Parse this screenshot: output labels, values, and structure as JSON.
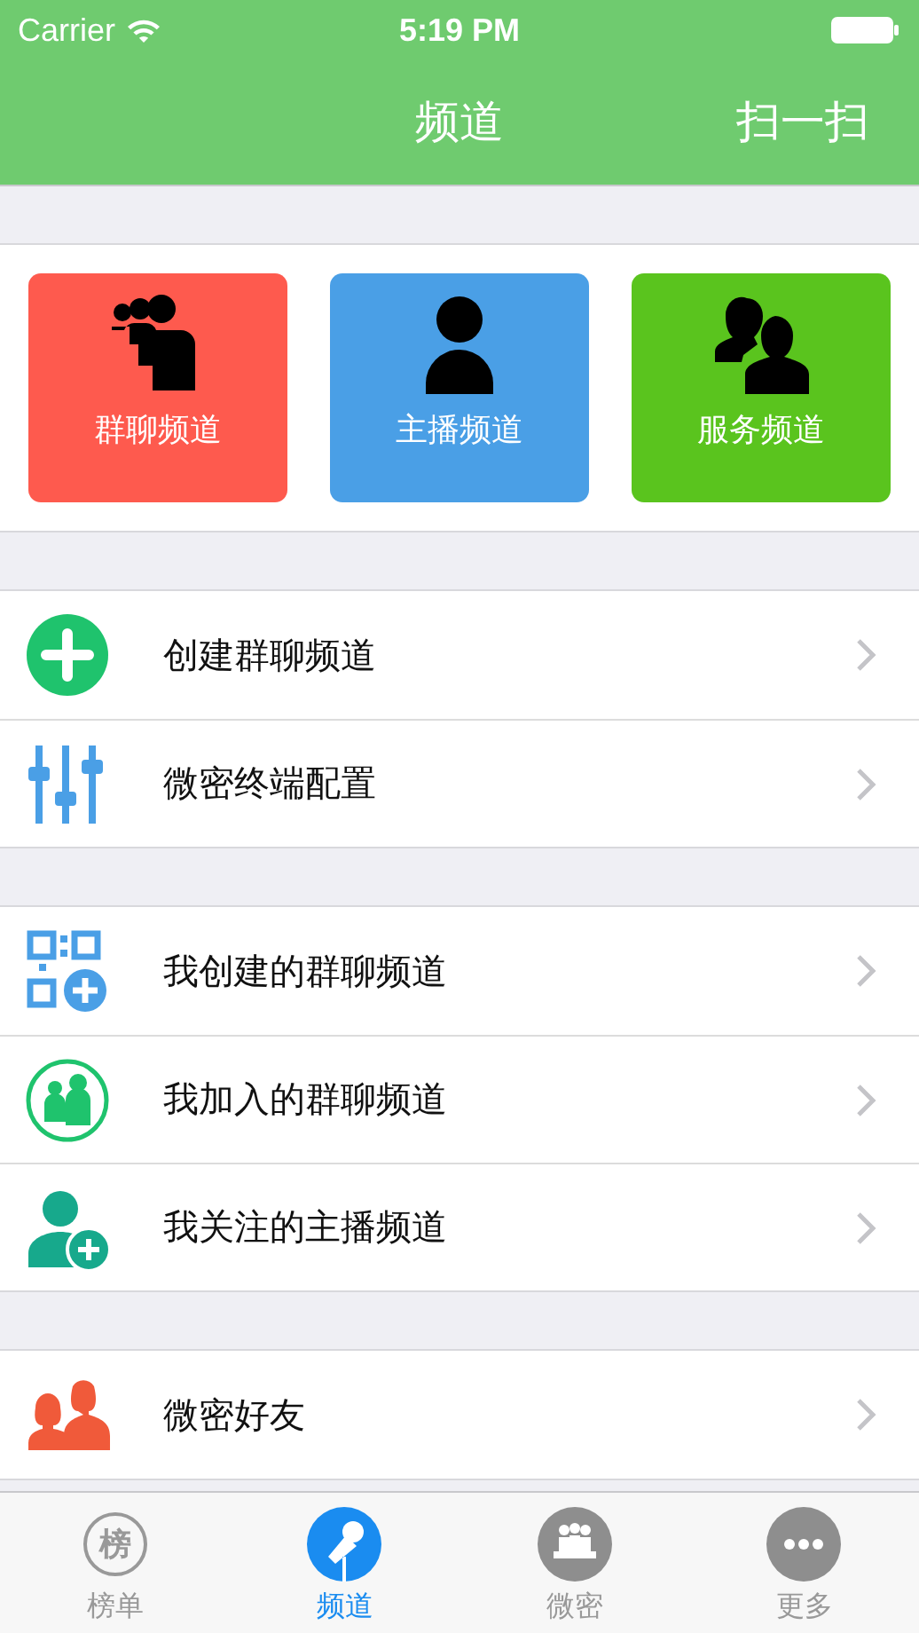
{
  "status_bar": {
    "carrier": "Carrier",
    "time": "5:19 PM"
  },
  "nav_bar": {
    "title": "频道",
    "action": "扫一扫"
  },
  "tiles": [
    {
      "label": "群聊频道",
      "color": "#fe5a4e",
      "kind": "group"
    },
    {
      "label": "主播频道",
      "color": "#4a9fe6",
      "kind": "person"
    },
    {
      "label": "服务频道",
      "color": "#5ac41e",
      "kind": "pair"
    }
  ],
  "menu_groups": [
    [
      {
        "label": "创建群聊频道",
        "kind": "add"
      },
      {
        "label": "微密终端配置",
        "kind": "sliders"
      }
    ],
    [
      {
        "label": "我创建的群聊频道",
        "kind": "qr"
      },
      {
        "label": "我加入的群聊频道",
        "kind": "members"
      },
      {
        "label": "我关注的主播频道",
        "kind": "follow"
      }
    ],
    [
      {
        "label": "微密好友",
        "kind": "friends"
      }
    ]
  ],
  "tab_bar": [
    {
      "label": "榜单",
      "glyph": "榜",
      "kind": "ranking",
      "selected": false
    },
    {
      "label": "频道",
      "kind": "mic",
      "selected": true
    },
    {
      "label": "微密",
      "kind": "crowd",
      "selected": false
    },
    {
      "label": "更多",
      "kind": "more",
      "selected": false
    }
  ]
}
